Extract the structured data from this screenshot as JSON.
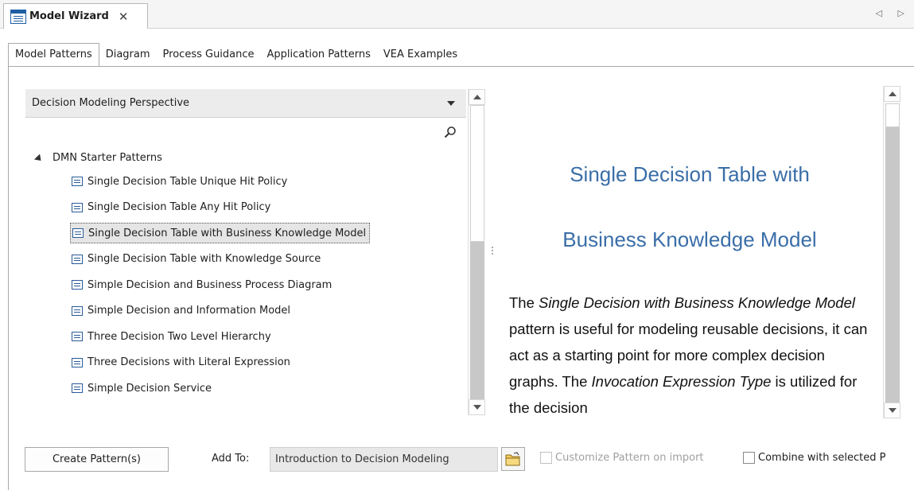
{
  "window": {
    "tab_title": "Model Wizard",
    "close_glyph": "✕",
    "scroll_arrows": "◁ ▷"
  },
  "tabs": [
    {
      "label": "Model Patterns",
      "active": true
    },
    {
      "label": "Diagram",
      "active": false
    },
    {
      "label": "Process Guidance",
      "active": false
    },
    {
      "label": "Application Patterns",
      "active": false
    },
    {
      "label": "VEA Examples",
      "active": false
    }
  ],
  "perspective": {
    "selected": "Decision Modeling Perspective"
  },
  "tree": {
    "group_label": "DMN Starter Patterns",
    "items": [
      {
        "label": "Single Decision Table Unique Hit Policy",
        "selected": false
      },
      {
        "label": "Single Decision Table Any Hit Policy",
        "selected": false
      },
      {
        "label": "Single Decision Table with Business Knowledge Model",
        "selected": true
      },
      {
        "label": "Single Decision Table with Knowledge Source",
        "selected": false
      },
      {
        "label": "Simple Decision and Business Process Diagram",
        "selected": false
      },
      {
        "label": "Simple Decision and Information Model",
        "selected": false
      },
      {
        "label": "Three Decision Two Level Hierarchy",
        "selected": false
      },
      {
        "label": "Three Decisions with Literal Expression",
        "selected": false
      },
      {
        "label": "Simple Decision Service",
        "selected": false
      }
    ]
  },
  "description": {
    "title_line1": "Single Decision Table with",
    "title_line2": "Business Knowledge Model",
    "body_p1": "The ",
    "body_em1": "Single Decision with Business Knowledge Model",
    "body_p2": " pattern is useful for modeling reusable decisions, it can act as a starting point for more complex decision graphs. The ",
    "body_em2": "Invocation Expression Type",
    "body_p3": " is utilized for the decision"
  },
  "bottom": {
    "create_button": "Create Pattern(s)",
    "add_to_label": "Add To:",
    "add_to_value": "Introduction to Decision Modeling",
    "customize_label": "Customize Pattern on import",
    "combine_label": "Combine with selected P"
  },
  "colors": {
    "accent_title": "#3a6ea8",
    "icon_blue": "#1f5fa5",
    "scroll_track": "#c8c8c8"
  },
  "icons": [
    "tab-document-icon",
    "close-icon",
    "dropdown-arrow-icon",
    "search-icon",
    "collapse-triangle-icon",
    "pattern-item-icon",
    "folder-icon"
  ]
}
